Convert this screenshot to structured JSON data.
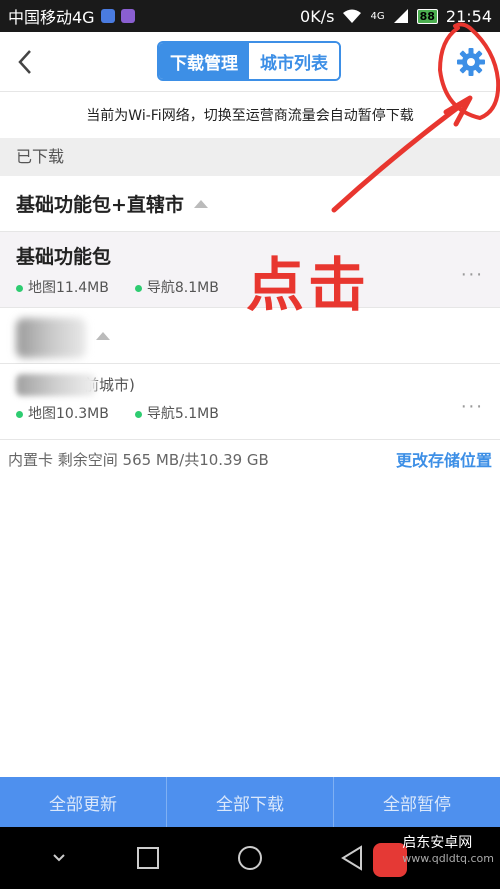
{
  "status_bar": {
    "carrier": "中国移动4G",
    "speed": "0K/s",
    "network": "4G",
    "battery": "88",
    "time": "21:54"
  },
  "header": {
    "tabs": [
      {
        "label": "下载管理",
        "active": true
      },
      {
        "label": "城市列表",
        "active": false
      }
    ]
  },
  "notice": "当前为Wi-Fi网络，切换至运营商流量会自动暂停下载",
  "section_title": "已下载",
  "groups": [
    {
      "title": "基础功能包+直辖市",
      "items": [
        {
          "name": "基础功能包",
          "map": "地图11.4MB",
          "nav": "导航8.1MB"
        }
      ]
    },
    {
      "title": "",
      "items": [
        {
          "name": "前城市)",
          "map": "地图10.3MB",
          "nav": "导航5.1MB"
        }
      ]
    }
  ],
  "more_label": "...",
  "storage": {
    "info": "内置卡 剩余空间 565 MB/共10.39 GB",
    "change_link": "更改存储位置"
  },
  "annotation": "点击",
  "bottom_actions": [
    "全部更新",
    "全部下载",
    "全部暂停"
  ],
  "watermark": {
    "name": "启东安卓网",
    "url": "www.qdldtq.com"
  },
  "colors": {
    "accent": "#3d8fe6",
    "annotation": "#e8362f",
    "dot": "#2ecc71",
    "bottom_bar": "#4e90ee"
  }
}
